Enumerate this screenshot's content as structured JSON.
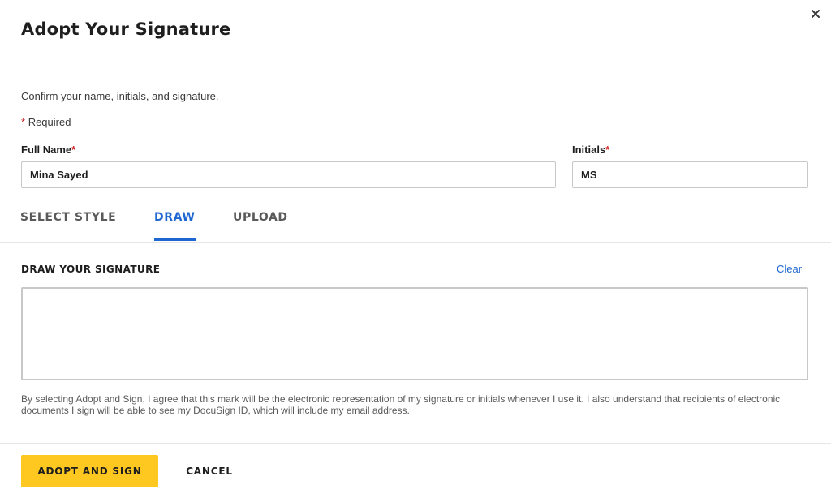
{
  "dialog": {
    "title": "Adopt Your Signature",
    "close_icon": "close-icon"
  },
  "form": {
    "subtitle": "Confirm your name, initials, and signature.",
    "required_mark": "*",
    "required_note": "Required",
    "full_name": {
      "label": "Full Name",
      "value": "Mina Sayed"
    },
    "initials": {
      "label": "Initials",
      "value": "MS"
    }
  },
  "tabs": [
    {
      "label": "SELECT STYLE",
      "active": false
    },
    {
      "label": "DRAW",
      "active": true
    },
    {
      "label": "UPLOAD",
      "active": false
    }
  ],
  "draw": {
    "section_label": "DRAW YOUR SIGNATURE",
    "clear_label": "Clear"
  },
  "disclaimer": "By selecting Adopt and Sign, I agree that this mark will be the electronic representation of my signature or initials whenever I use it. I also understand that recipients of electronic documents I sign will be able to see my DocuSign ID, which will include my email address.",
  "footer": {
    "adopt_label": "ADOPT AND SIGN",
    "cancel_label": "CANCEL"
  },
  "colors": {
    "accent": "#1e66d0",
    "primary_button": "#ffc820",
    "required": "#cc1e1e"
  }
}
